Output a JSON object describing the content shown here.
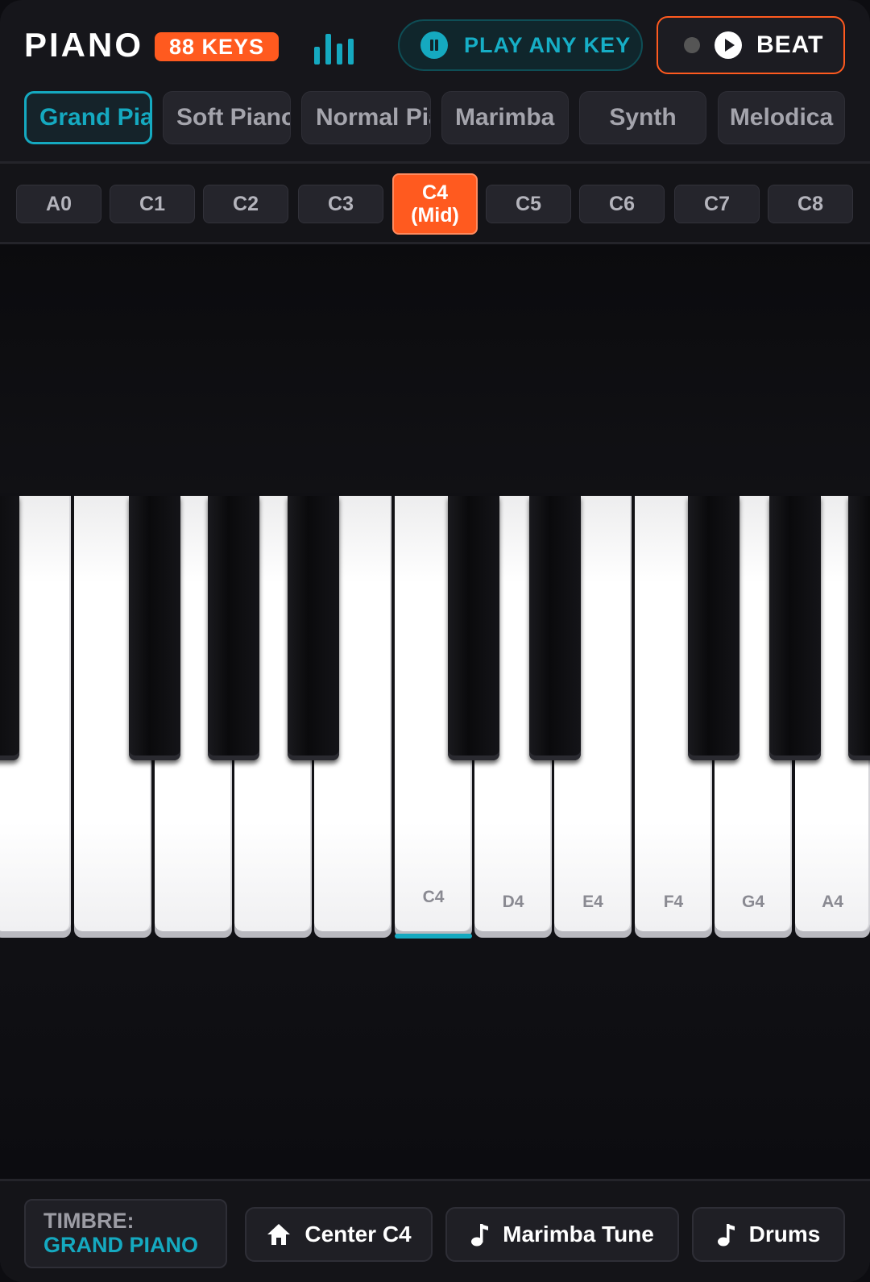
{
  "header": {
    "title": "PIANO",
    "keys_badge": "88 KEYS",
    "play_any_key_label": "PLAY ANY KEY",
    "beat_label": "BEAT"
  },
  "instruments": [
    {
      "label": "Grand Piano",
      "active": true
    },
    {
      "label": "Soft Piano",
      "active": false
    },
    {
      "label": "Normal Piano",
      "active": false
    },
    {
      "label": "Marimba",
      "active": false
    },
    {
      "label": "Synth",
      "active": false
    },
    {
      "label": "Melodica",
      "active": false
    }
  ],
  "octaves": [
    {
      "label": "A0"
    },
    {
      "label": "C1"
    },
    {
      "label": "C2"
    },
    {
      "label": "C3"
    },
    {
      "label": "C4",
      "sub": "(Mid)",
      "active": true
    },
    {
      "label": "C5"
    },
    {
      "label": "C6"
    },
    {
      "label": "C7"
    },
    {
      "label": "C8"
    }
  ],
  "keyboard": {
    "white_key_labels": [
      "",
      "",
      "",
      "",
      "",
      "C4",
      "D4",
      "E4",
      "F4",
      "G4",
      "A4"
    ],
    "highlighted_key": "C4"
  },
  "footer": {
    "timbre_label": "TIMBRE:",
    "timbre_value": "GRAND PIANO",
    "center_button": "Center C4",
    "marimba_button": "Marimba Tune",
    "drums_button": "Drums"
  },
  "colors": {
    "accent_orange": "#ff5a1f",
    "accent_teal": "#15a9c0",
    "background": "#16161b"
  }
}
